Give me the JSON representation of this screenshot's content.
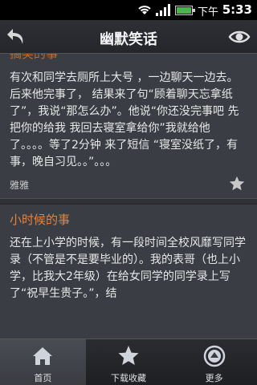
{
  "status_bar": {
    "period": "下午",
    "time": "5:33"
  },
  "header": {
    "title": "幽默笑话"
  },
  "jokes": [
    {
      "partial_title": "搞笑的事",
      "text": "有次和同学去厕所上大号 ，一边聊天一边去。后来他完事了， 结果来了句“顾着聊天忘拿纸了”，我说“那怎么办”。他说“你还没完事吧 先把你的给我 我回去寝室拿给你”我就给他了。。。。等了2分钟 来了短信 “寝室没纸了，有事，晚自习见。。”。。。",
      "author": "雅雅"
    },
    {
      "title": "小时候的事",
      "text": "还在上小学的时候，有一段时间全校风靡写同学录（不管是不是要毕业的）。我的表哥（也上小学，比我大2年级）在给女同学的同学录上写了“祝早生贵子。”，结"
    }
  ],
  "bottom_nav": [
    {
      "label": "首页",
      "icon": "home-icon",
      "active": true
    },
    {
      "label": "下载收藏",
      "icon": "star-icon",
      "active": false
    },
    {
      "label": "更多",
      "icon": "more-icon",
      "active": false
    }
  ]
}
